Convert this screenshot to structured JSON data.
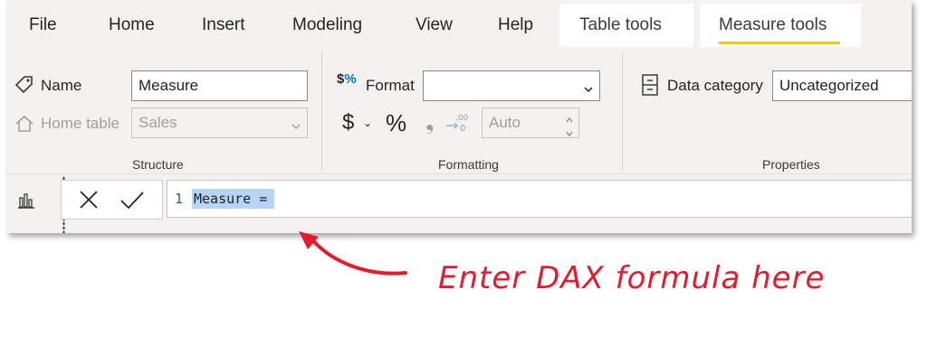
{
  "menu": {
    "tabs": [
      {
        "label": "File"
      },
      {
        "label": "Home"
      },
      {
        "label": "Insert"
      },
      {
        "label": "Modeling"
      },
      {
        "label": "View"
      },
      {
        "label": "Help"
      }
    ],
    "contextual": [
      {
        "label": "Table tools",
        "active": false
      },
      {
        "label": "Measure tools",
        "active": true
      }
    ],
    "accent": "#f2c811"
  },
  "structure": {
    "name_label": "Name",
    "name_value": "Measure",
    "home_table_label": "Home table",
    "home_table_value": "Sales",
    "group_label": "Structure"
  },
  "formatting": {
    "format_label": "Format",
    "format_value": "",
    "currency_symbol": "$",
    "percent_symbol": "%",
    "comma_symbol": "❟",
    "decimal_places_placeholder": "Auto",
    "group_label": "Formatting"
  },
  "properties": {
    "data_category_label": "Data category",
    "data_category_value": "Uncategorized",
    "group_label": "Properties"
  },
  "formula_bar": {
    "line_number": "1",
    "formula_text": "Measure =",
    "selection_color": "#b7d6f5"
  },
  "annotation": {
    "text": "Enter DAX formula here",
    "color": "#e8192c"
  }
}
